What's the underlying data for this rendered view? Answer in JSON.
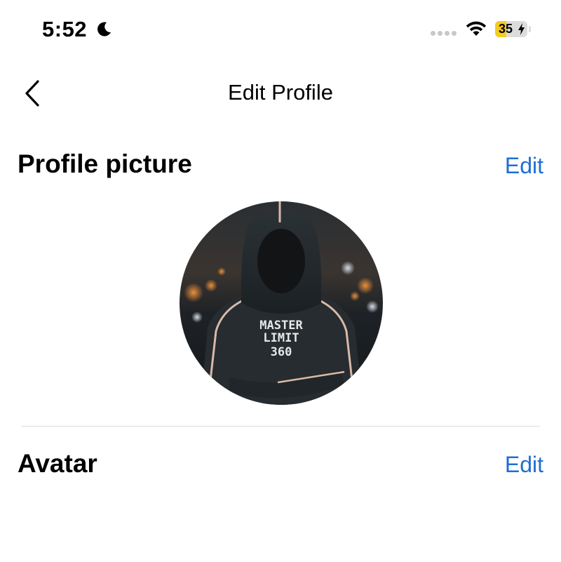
{
  "status_bar": {
    "time": "5:52",
    "battery_level": "35",
    "battery_percent": 35,
    "battery_color": "#f5cc1e",
    "icons": [
      "moon-icon",
      "signal-dots-icon",
      "wifi-icon",
      "battery-icon",
      "charging-bolt-icon"
    ]
  },
  "nav": {
    "title": "Edit Profile",
    "back_icon": "chevron-left-icon"
  },
  "profile_picture": {
    "title": "Profile picture",
    "edit_label": "Edit",
    "image_text_line1": "MASTER",
    "image_text_line2": "LIMIT",
    "image_text_line3": "360"
  },
  "avatar": {
    "title": "Avatar",
    "edit_label": "Edit"
  },
  "colors": {
    "link": "#1f6fd1",
    "divider": "#dedede"
  }
}
